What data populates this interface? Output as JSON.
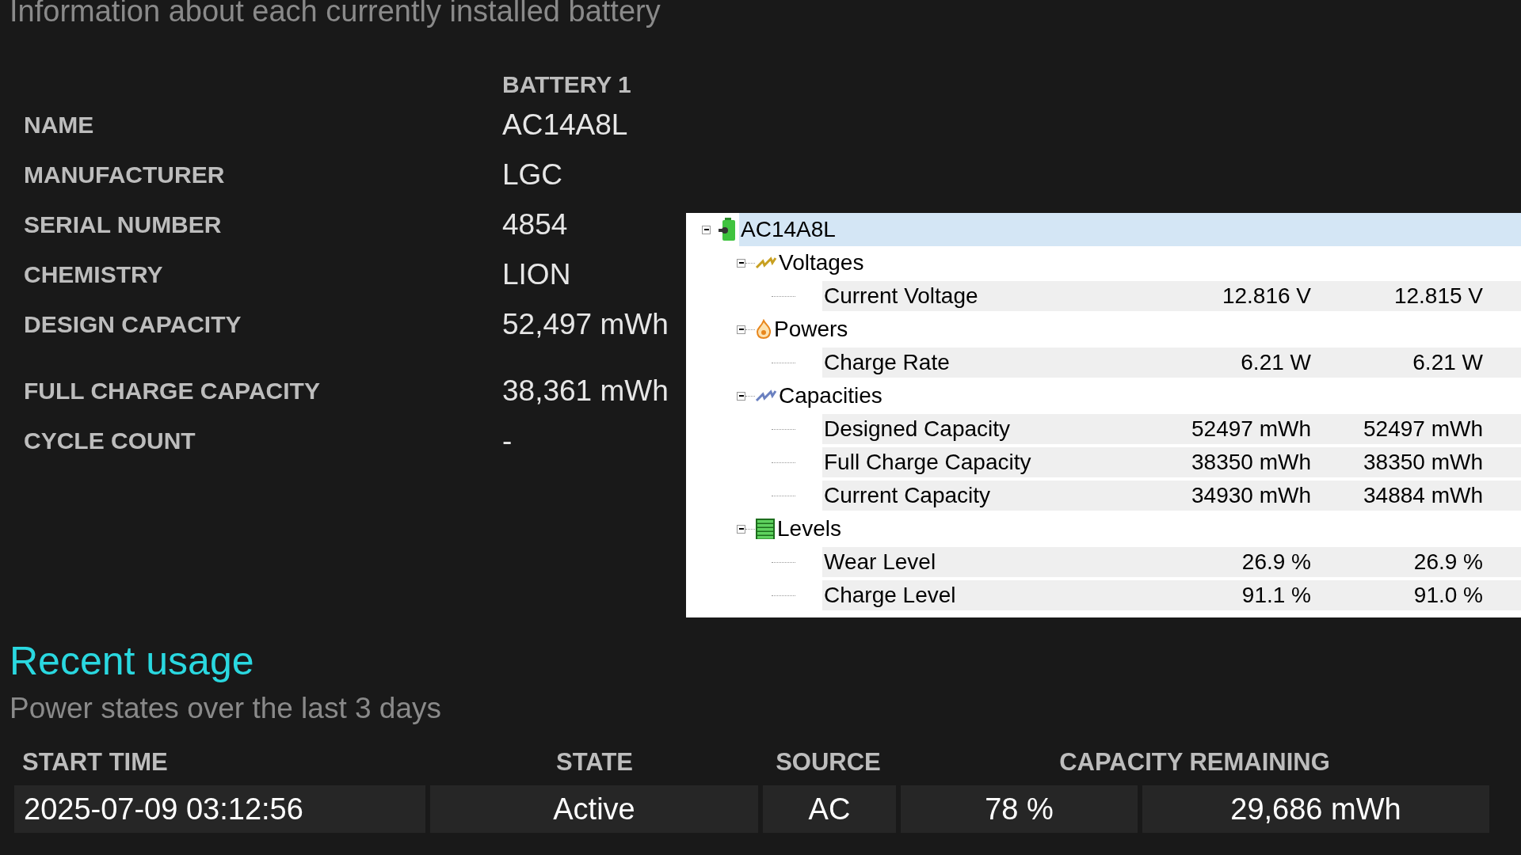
{
  "intro": "Information about each currently installed battery",
  "battery_table": {
    "column_heading": "BATTERY 1",
    "rows": [
      {
        "label": "NAME",
        "value": "AC14A8L"
      },
      {
        "label": "MANUFACTURER",
        "value": "LGC"
      },
      {
        "label": "SERIAL NUMBER",
        "value": "4854"
      },
      {
        "label": "CHEMISTRY",
        "value": "LION"
      },
      {
        "label": "DESIGN CAPACITY",
        "value": "52,497 mWh"
      },
      {
        "label": "FULL CHARGE CAPACITY",
        "value": "38,361 mWh"
      },
      {
        "label": "CYCLE COUNT",
        "value": "-"
      }
    ]
  },
  "sensor_tree": {
    "root": {
      "label": "AC14A8L",
      "expanded": true,
      "selected": true,
      "children": [
        {
          "kind": "voltages",
          "label": "Voltages",
          "expanded": true,
          "selected": false,
          "children": [
            {
              "label": "Current Voltage",
              "values": [
                "12.816 V",
                "12.815 V"
              ],
              "selected": false
            }
          ]
        },
        {
          "kind": "powers",
          "label": "Powers",
          "expanded": true,
          "selected": false,
          "children": [
            {
              "label": "Charge Rate",
              "values": [
                "6.21 W",
                "6.21 W"
              ],
              "selected": false
            }
          ]
        },
        {
          "kind": "capacities",
          "label": "Capacities",
          "expanded": true,
          "selected": false,
          "children": [
            {
              "label": "Designed Capacity",
              "values": [
                "52497 mWh",
                "52497 mWh"
              ],
              "selected": false
            },
            {
              "label": "Full Charge Capacity",
              "values": [
                "38350 mWh",
                "38350 mWh"
              ],
              "selected": false
            },
            {
              "label": "Current Capacity",
              "values": [
                "34930 mWh",
                "34884 mWh"
              ],
              "selected": false
            }
          ]
        },
        {
          "kind": "levels",
          "label": "Levels",
          "expanded": true,
          "selected": false,
          "children": [
            {
              "label": "Wear Level",
              "values": [
                "26.9 %",
                "26.9 %"
              ],
              "selected": false
            },
            {
              "label": "Charge Level",
              "values": [
                "91.1 %",
                "91.0 %"
              ],
              "selected": false
            }
          ]
        }
      ]
    }
  },
  "recent_usage": {
    "title": "Recent usage",
    "subtitle": "Power states over the last 3 days",
    "columns": [
      "START TIME",
      "STATE",
      "SOURCE",
      "CAPACITY REMAINING"
    ],
    "rows": [
      {
        "start_time": "2025-07-09  03:12:56",
        "state": "Active",
        "source": "AC",
        "capacity_percent": "78 %",
        "capacity_energy": "29,686 mWh"
      }
    ]
  }
}
